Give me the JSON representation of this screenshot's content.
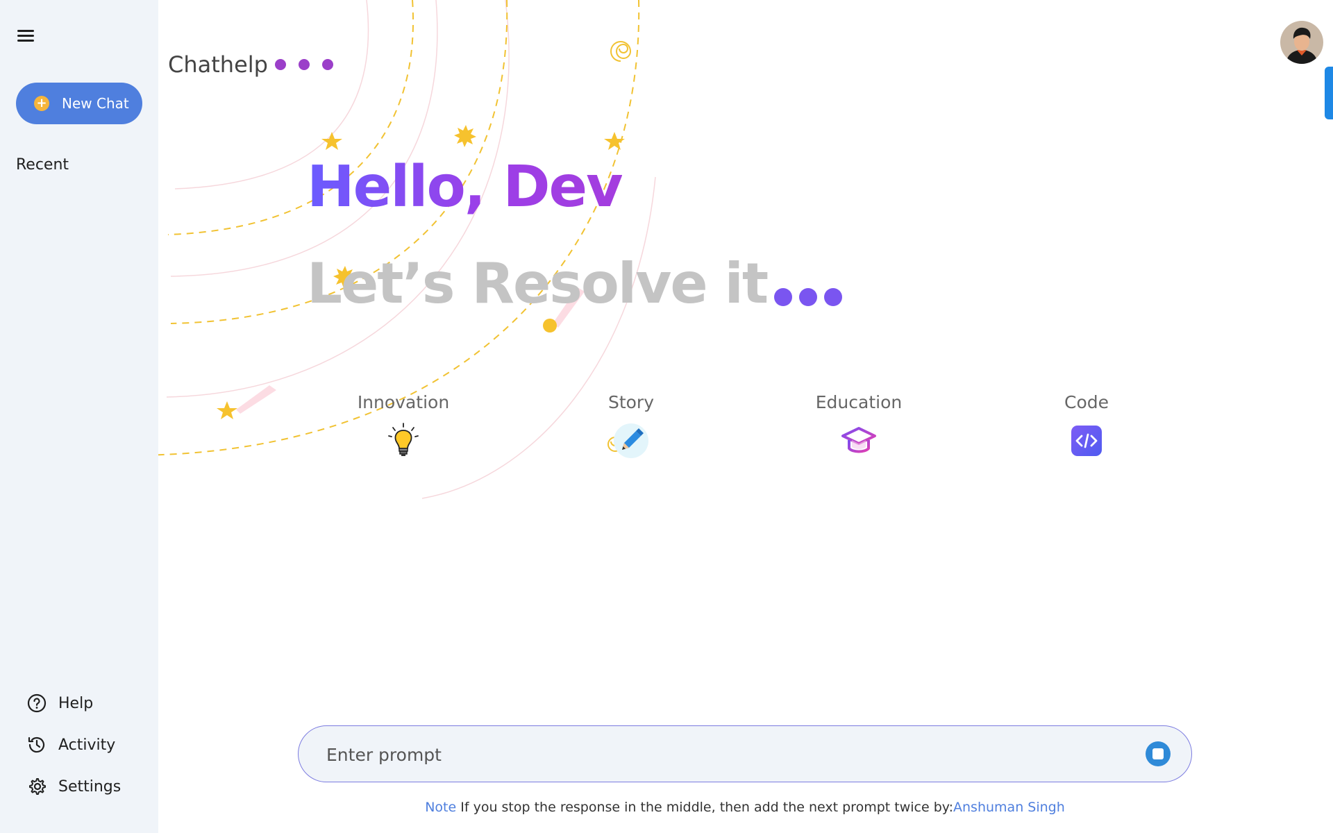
{
  "sidebar": {
    "new_chat_label": "New Chat",
    "recent_label": "Recent",
    "bottom_items": [
      {
        "label": "Help",
        "icon": "help-circle-icon"
      },
      {
        "label": "Activity",
        "icon": "history-icon"
      },
      {
        "label": "Settings",
        "icon": "gear-icon"
      }
    ]
  },
  "header": {
    "brand": "Chathelp"
  },
  "greeting": {
    "hello": "Hello, Dev",
    "subtitle": "Let’s Resolve it"
  },
  "cards": [
    {
      "label": "Innovation",
      "icon": "lightbulb-icon"
    },
    {
      "label": "Story",
      "icon": "pencil-icon"
    },
    {
      "label": "Education",
      "icon": "graduation-cap-icon"
    },
    {
      "label": "Code",
      "icon": "code-icon"
    }
  ],
  "prompt": {
    "placeholder": "Enter prompt"
  },
  "footnote": {
    "note": "Note",
    "text": " If you stop the response in the middle, then add the next prompt twice by:",
    "author": "Anshuman Singh"
  },
  "colors": {
    "accent": "#4f7fde",
    "gradient_start": "#6a5cff",
    "gradient_end": "#a43dde",
    "send": "#2f8ad8",
    "sidebar_bg": "#f0f4f9"
  }
}
